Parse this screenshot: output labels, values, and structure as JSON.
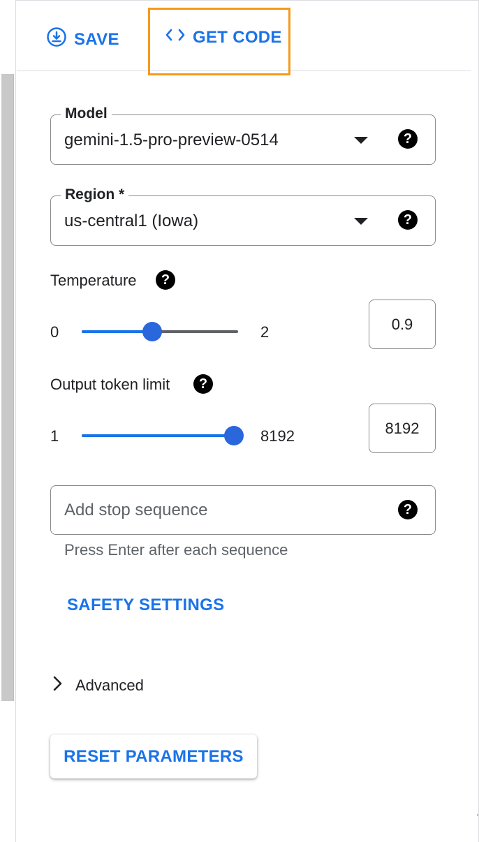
{
  "toolbar": {
    "save_label": "SAVE",
    "get_code_label": "GET CODE"
  },
  "model": {
    "legend": "Model",
    "value": "gemini-1.5-pro-preview-0514"
  },
  "region": {
    "legend": "Region *",
    "value": "us-central1 (Iowa)"
  },
  "temperature": {
    "label": "Temperature",
    "min": "0",
    "max": "2",
    "value": "0.9",
    "fraction": 0.45
  },
  "token_limit": {
    "label": "Output token limit",
    "min": "1",
    "max": "8192",
    "value": "8192",
    "fraction": 1.0
  },
  "stop_sequence": {
    "placeholder": "Add stop sequence",
    "hint": "Press Enter after each sequence"
  },
  "safety_settings_label": "SAFETY SETTINGS",
  "advanced_label": "Advanced",
  "reset_label": "RESET PARAMETERS",
  "help_glyph": "?",
  "colors": {
    "accent": "#1a73e8",
    "highlight": "#f59a1b",
    "slider_thumb": "#2a66dc"
  }
}
